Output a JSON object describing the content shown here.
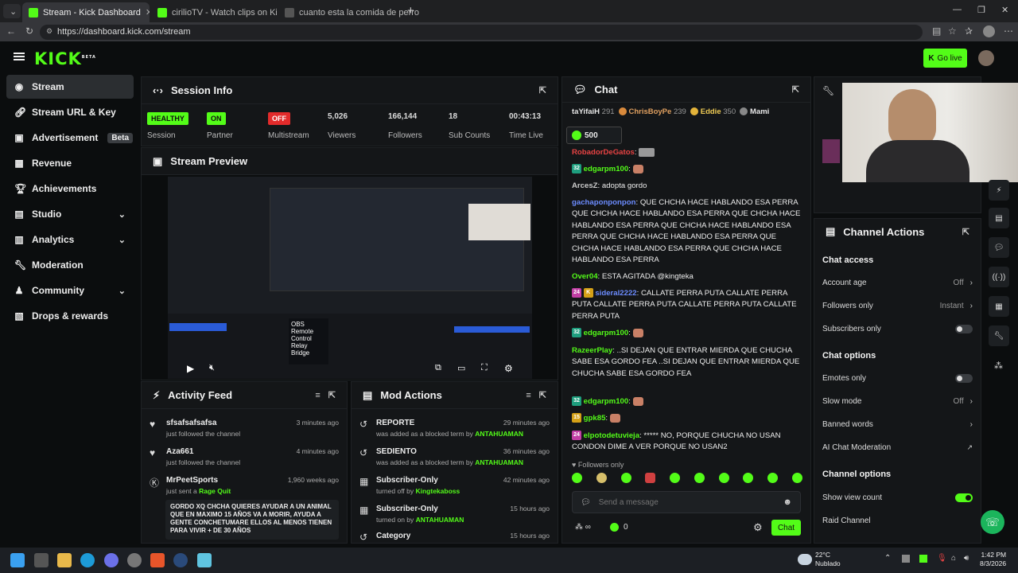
{
  "browser": {
    "tabs": [
      {
        "label": "Stream - Kick Dashboard",
        "active": true
      },
      {
        "label": "cirilioTV - Watch clips on Kick",
        "active": false
      },
      {
        "label": "cuanto esta la comida de perro - S",
        "active": false
      }
    ],
    "url": "https://dashboard.kick.com/stream"
  },
  "brand": {
    "logo": "KICK",
    "logo_sup": "BETA",
    "accent": "#53fc18"
  },
  "topbar": {
    "go_live": "Go live"
  },
  "sidebar": {
    "items": [
      {
        "label": "Stream",
        "icon": "broadcast-icon"
      },
      {
        "label": "Stream URL & Key",
        "icon": "link-icon"
      },
      {
        "label": "Advertisement",
        "badge": "Beta",
        "icon": "ad-icon"
      },
      {
        "label": "Revenue",
        "icon": "revenue-icon"
      },
      {
        "label": "Achievements",
        "icon": "trophy-icon"
      },
      {
        "label": "Studio",
        "icon": "studio-icon"
      },
      {
        "label": "Analytics",
        "icon": "analytics-icon"
      },
      {
        "label": "Moderation",
        "icon": "wrench-icon"
      },
      {
        "label": "Community",
        "icon": "users-icon"
      },
      {
        "label": "Drops & rewards",
        "icon": "gift-icon"
      }
    ]
  },
  "session": {
    "title": "Session Info",
    "stats": [
      {
        "badge": "HEALTHY",
        "label": "Session"
      },
      {
        "badge": "ON",
        "label": "Partner"
      },
      {
        "badge": "OFF",
        "label": "Multistream"
      },
      {
        "value": "5,026",
        "label": "Viewers"
      },
      {
        "value": "166,144",
        "label": "Followers"
      },
      {
        "value": "18",
        "label": "Sub Counts"
      },
      {
        "value": "00:43:13",
        "label": "Time Live"
      }
    ]
  },
  "preview": {
    "title": "Stream Preview",
    "overlay_text": [
      "OBS",
      "Remote",
      "Control",
      "Relay",
      "Bridge"
    ]
  },
  "activity": {
    "title": "Activity Feed",
    "items": [
      {
        "name": "sfsafsafsafsa",
        "sub": "just followed the channel",
        "time": "3 minutes ago"
      },
      {
        "name": "Aza661",
        "sub": "just followed the channel",
        "time": "4 minutes ago"
      },
      {
        "name": "MrPeetSports",
        "sub": "just sent a",
        "sub_hl": "Rage Quit",
        "time": "1,960 weeks ago",
        "msg": "GORDO XQ CHCHA QUIERES AYUDAR A UN ANIMAL QUE EN MAXIMO 15 AÑOS VA A MORIR, AYUDA A GENTE CONCHETUMARE ELLOS AL MENOS TIENEN PARA VIVIR + DE 30 AÑOS"
      }
    ]
  },
  "mod": {
    "title": "Mod Actions",
    "items": [
      {
        "name": "REPORTE",
        "pre": "was added as a blocked term by",
        "by": "ANTAHUAMAN",
        "time": "29 minutes ago"
      },
      {
        "name": "SEDIENTO",
        "pre": "was added as a blocked term by",
        "by": "ANTAHUAMAN",
        "time": "36 minutes ago"
      },
      {
        "name": "Subscriber-Only",
        "pre": "turned off by",
        "by": "Kingtekaboss",
        "time": "42 minutes ago"
      },
      {
        "name": "Subscriber-Only",
        "pre": "turned on by",
        "by": "ANTAHUAMAN",
        "time": "15 hours ago"
      },
      {
        "name": "Category",
        "pre": "",
        "by": "",
        "time": "15 hours ago"
      }
    ]
  },
  "chat": {
    "title": "Chat",
    "leaders": [
      {
        "name": "taYifaiH",
        "pts": "291"
      },
      {
        "name": "ChrisBoyPe",
        "pts": "239"
      },
      {
        "name": "Eddie",
        "pts": "350"
      },
      {
        "name": "Mami",
        "pts": ""
      }
    ],
    "pinned_amount": "500",
    "messages": [
      {
        "user": "RobadorDeGatos",
        "color": "#e84343",
        "text": ":"
      },
      {
        "user": "edgarpm100",
        "color": "#53fc18",
        "text": ":"
      },
      {
        "user": "ArcesZ",
        "color": "#cccccc",
        "text": ": adopta gordo"
      },
      {
        "user": "gachaponponpon",
        "color": "#6c8cff",
        "text": ": QUE CHCHA HACE HABLANDO ESA PERRA QUE CHCHA HACE HABLANDO ESA PERRA QUE CHCHA HACE HABLANDO ESA PERRA QUE CHCHA HACE HABLANDO ESA PERRA QUE CHCHA HACE HABLANDO ESA PERRA QUE CHCHA HACE HABLANDO ESA PERRA QUE CHCHA HACE HABLANDO ESA PERRA"
      },
      {
        "user": "Over04",
        "color": "#53fc18",
        "text": ": ESTA AGITADA @kingteka"
      },
      {
        "user": "sideral2222",
        "color": "#6c8cff",
        "text": ": CALLATE PERRA PUTA CALLATE PERRA PUTA CALLATE PERRA PUTA CALLATE PERRA PUTA CALLATE PERRA PUTA"
      },
      {
        "user": "edgarpm100",
        "color": "#53fc18",
        "text": ":"
      },
      {
        "user": "RazeerPlay",
        "color": "#53fc18",
        "text": ": ..SI DEJAN QUE ENTRAR MIERDA QUE CHUCHA SABE ESA GORDO FEA ..SI DEJAN QUE ENTRAR MIERDA QUE CHUCHA SABE ESA GORDO FEA"
      },
      {
        "user": "edgarpm100",
        "color": "#53fc18",
        "text": ":"
      },
      {
        "user": "gpk85",
        "color": "#53fc18",
        "text": ":"
      },
      {
        "user": "elpotodetuvieja",
        "color": "#53fc18",
        "text": ": ***** NO, PORQUE CHUCHA NO USAN CONDON DIME A VER PORQUE NO USAN2"
      }
    ],
    "followers_only": "Followers only",
    "input_placeholder": "Send a message",
    "count": "0",
    "send_label": "Chat"
  },
  "actions": {
    "title": "Channel Actions",
    "chat_access": "Chat access",
    "account_age": {
      "label": "Account age",
      "value": "Off"
    },
    "followers_only": {
      "label": "Followers only",
      "value": "Instant"
    },
    "subscribers_only": {
      "label": "Subscribers only"
    },
    "chat_options": "Chat options",
    "emotes_only": {
      "label": "Emotes only"
    },
    "slow_mode": {
      "label": "Slow mode",
      "value": "Off"
    },
    "banned_words": {
      "label": "Banned words"
    },
    "ai_mod": {
      "label": "AI Chat Moderation"
    },
    "channel_options": "Channel options",
    "show_view_count": {
      "label": "Show view count",
      "on": true
    },
    "raid": {
      "label": "Raid Channel"
    }
  },
  "taskbar": {
    "weather_temp": "22°C",
    "weather_desc": "Nublado",
    "time": "1:42 PM",
    "date": "8/3/2026"
  }
}
